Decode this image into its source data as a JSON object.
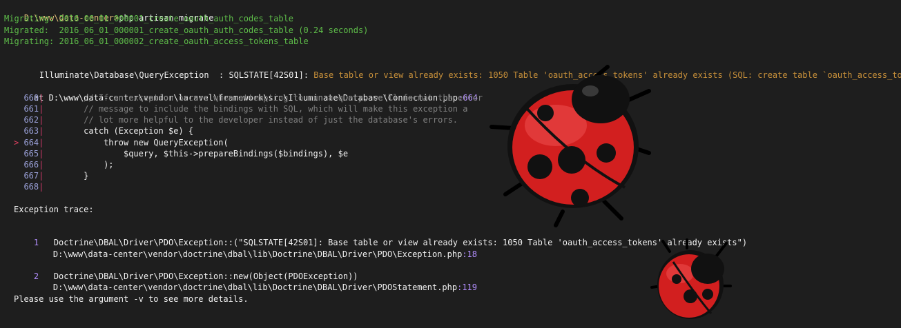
{
  "prompt": "D:\\www\\data-center>",
  "command": "php artisan migrate",
  "migrations": [
    "Migrating: 2016_06_01_000001_create_oauth_auth_codes_table",
    "Migrated:  2016_06_01_000001_create_oauth_auth_codes_table (0.24 seconds)",
    "Migrating: 2016_06_01_000002_create_oauth_access_tokens_table"
  ],
  "exception": {
    "class": "Illuminate\\Database\\QueryException",
    "separator": "  : ",
    "state": "SQLSTATE[42S01]:",
    "message": " Base table or view already exists: 1050 Table 'oauth_access_tokens' already exists (SQL: create table `oauth_access_tokens`",
    "at_label": "at ",
    "at_path": "D:\\www\\data-center\\vendor\\laravel\\framework\\src\\Illuminate\\Database\\Connection.php",
    "at_line": ":664"
  },
  "code_lines": [
    {
      "no": "660",
      "code": "        // If an exception occurs when attempting to run a query, we'll format the error",
      "comment": true,
      "current": false
    },
    {
      "no": "661",
      "code": "        // message to include the bindings with SQL, which will make this exception a",
      "comment": true,
      "current": false
    },
    {
      "no": "662",
      "code": "        // lot more helpful to the developer instead of just the database's errors.",
      "comment": true,
      "current": false
    },
    {
      "no": "663",
      "code": "        catch (Exception $e) {",
      "comment": false,
      "current": false
    },
    {
      "no": "664",
      "code": "            throw new QueryException(",
      "comment": false,
      "current": true
    },
    {
      "no": "665",
      "code": "                $query, $this->prepareBindings($bindings), $e",
      "comment": false,
      "current": false
    },
    {
      "no": "666",
      "code": "            );",
      "comment": false,
      "current": false
    },
    {
      "no": "667",
      "code": "        }",
      "comment": false,
      "current": false
    },
    {
      "no": "668",
      "code": "",
      "comment": false,
      "current": false
    }
  ],
  "trace_title": "Exception trace:",
  "trace": [
    {
      "index": "1",
      "call": "Doctrine\\DBAL\\Driver\\PDO\\Exception::(\"SQLSTATE[42S01]: Base table or view already exists: 1050 Table 'oauth_access_tokens' already exists\")",
      "file": "D:\\www\\data-center\\vendor\\doctrine\\dbal\\lib\\Doctrine\\DBAL\\Driver\\PDO\\Exception.php",
      "line": ":18"
    },
    {
      "index": "2",
      "call": "Doctrine\\DBAL\\Driver\\PDO\\Exception::new(Object(PDOException))",
      "file": "D:\\www\\data-center\\vendor\\doctrine\\dbal\\lib\\Doctrine\\DBAL\\Driver\\PDOStatement.php",
      "line": ":119"
    }
  ],
  "help_text": "Please use the argument -v to see more details.",
  "current_marker": ">",
  "colors": {
    "background": "#1e1e1e",
    "prompt": "#e5c07b",
    "migration": "#5fbf4a",
    "error": "#c8903a",
    "line_number": "#b38fff",
    "comment": "#7f7f7f",
    "ladybug_red": "#d21f1f"
  }
}
